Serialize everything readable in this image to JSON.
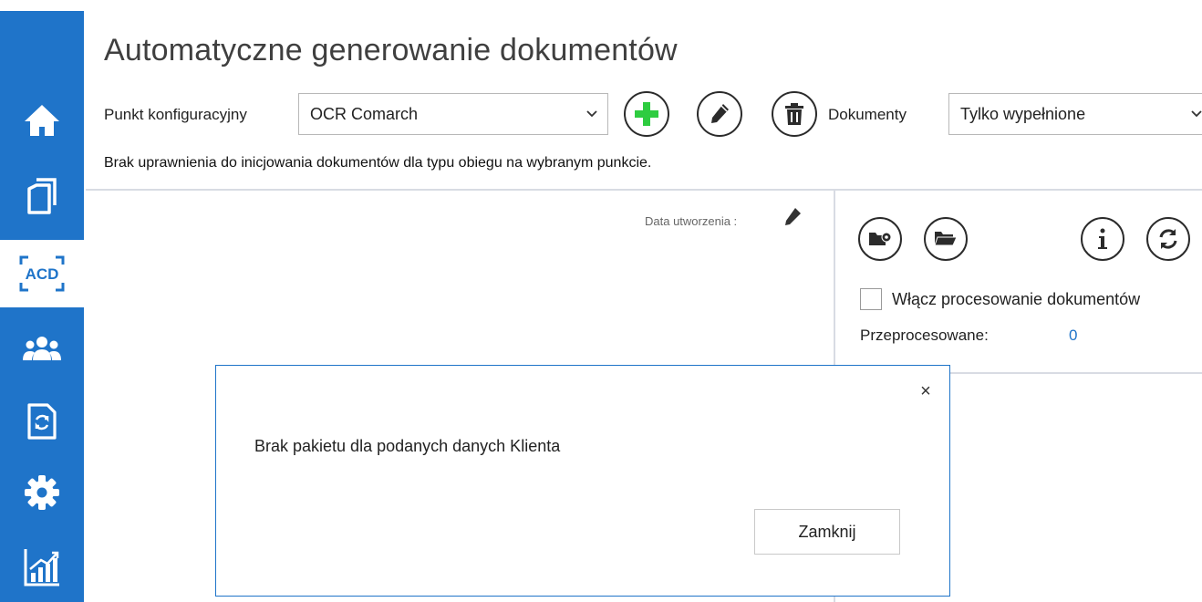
{
  "header": {
    "title": "Automatyczne generowanie dokumentów"
  },
  "toolbar": {
    "config_point_label": "Punkt konfiguracyjny",
    "config_point_value": "OCR Comarch",
    "documents_label": "Dokumenty",
    "documents_value": "Tylko wypełnione"
  },
  "warning_text": "Brak uprawnienia do inicjowania dokumentów dla typu obiegu na wybranym punkcie.",
  "left_panel": {
    "date_label": "Data utworzenia :"
  },
  "right_panel": {
    "enable_processing_label": "Włącz procesowanie dokumentów",
    "processed_label": "Przeprocesowane:",
    "processed_value": "0"
  },
  "dialog": {
    "message": "Brak pakietu dla podanych danych Klienta",
    "close_symbol": "×",
    "close_button": "Zamknij"
  },
  "sidebar": {
    "items": [
      {
        "icon": "home-icon"
      },
      {
        "icon": "documents-icon"
      },
      {
        "icon": "acd-icon",
        "label": "ACD",
        "active": true
      },
      {
        "icon": "users-icon"
      },
      {
        "icon": "document-sync-icon"
      },
      {
        "icon": "gear-icon"
      },
      {
        "icon": "chart-icon"
      }
    ]
  },
  "colors": {
    "sidebar": "#1f74c9",
    "add_button": "#2ecc40",
    "link_value": "#1f74c9",
    "dialog_border": "#1f74c9"
  }
}
